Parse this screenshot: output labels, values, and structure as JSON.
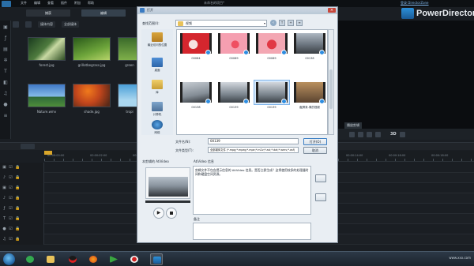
{
  "app": {
    "menu": [
      "文件",
      "编辑",
      "查看",
      "插件",
      "附加",
      "帮助"
    ],
    "document_title": "未命名的项目*",
    "login_link": "登录 DirectorZone",
    "brand": "PowerDirector",
    "modes": [
      "捕获",
      "编辑"
    ],
    "library_toolbar": {
      "filter_label": "媒体内容",
      "dropdown_label": "全部媒体"
    },
    "media": [
      {
        "label": "forest.jpg",
        "icon": "forest-thumbnail"
      },
      {
        "label": "grillotbegrass.jpg",
        "icon": "grass-thumbnail"
      },
      {
        "label": "green",
        "icon": "green-thumbnail"
      },
      {
        "label": "Nature.wmv",
        "icon": "nature-thumbnail"
      },
      {
        "label": "shade.jpg",
        "icon": "shade-thumbnail"
      },
      {
        "label": "tropi",
        "icon": "tropical-thumbnail"
      }
    ],
    "preview_label": "播放剪辑",
    "preview_quality": "3D",
    "ruler_ticks": [
      "00:00:00:00",
      "00:00:02:00",
      "00:00:04:00",
      "00:00:06:00",
      "00:00:08:00",
      "00:00:10:00",
      "00:00:12:00",
      "00:00:14:00",
      "00:00:16:00",
      "00:00:18:00"
    ]
  },
  "dialog": {
    "title": "打开",
    "look_in_label": "查找范围(I):",
    "look_in_value": "视频",
    "places": [
      {
        "label": "最近访问的位置",
        "icon": "recent-places-icon"
      },
      {
        "label": "桌面",
        "icon": "desktop-icon"
      },
      {
        "label": "库",
        "icon": "libraries-icon"
      },
      {
        "label": "计算机",
        "icon": "computer-icon"
      },
      {
        "label": "网络",
        "icon": "network-icon"
      }
    ],
    "files": [
      {
        "name": "00064",
        "thumb": "f-red"
      },
      {
        "name": "00069",
        "thumb": "f-pink"
      },
      {
        "name": "00069",
        "thumb": "f-pink2"
      },
      {
        "name": "00138",
        "thumb": "f-car"
      },
      {
        "name": "00138",
        "thumb": "f-car2"
      },
      {
        "name": "00139",
        "thumb": "f-car3"
      },
      {
        "name": "00139",
        "thumb": "f-car3"
      },
      {
        "name": "截屏录-周的视频",
        "thumb": "f-crowd"
      }
    ],
    "selected_index": 6,
    "filename_label": "文件名(N):",
    "filename_value": "00139",
    "filetype_label": "文件类型(T):",
    "filetype_value": "全部媒体文件 (*.mpg;*.mpeg;*.mpe;*.m2v;*.avi;*.dat;*.wmv;*.asf)",
    "open_button": "打开(O)",
    "cancel_button": "取消",
    "lower_label": "本剪辑的 AtiVideo",
    "info_label": "AtiVideo 信息",
    "info_text": "剪辑文件不包含提示信息的 AtiVideo 信息。是否立即生成？这将使用较多的处理器时间和硬盘空间资源。",
    "notes_label": "备注"
  },
  "taskbar": {
    "apps": [
      "explorer-icon",
      "media-player-icon",
      "qq-icon",
      "firefox-icon",
      "media-center-icon",
      "recorder-icon",
      "powerdirector-icon"
    ],
    "tray_text": "www.xxx.com"
  }
}
